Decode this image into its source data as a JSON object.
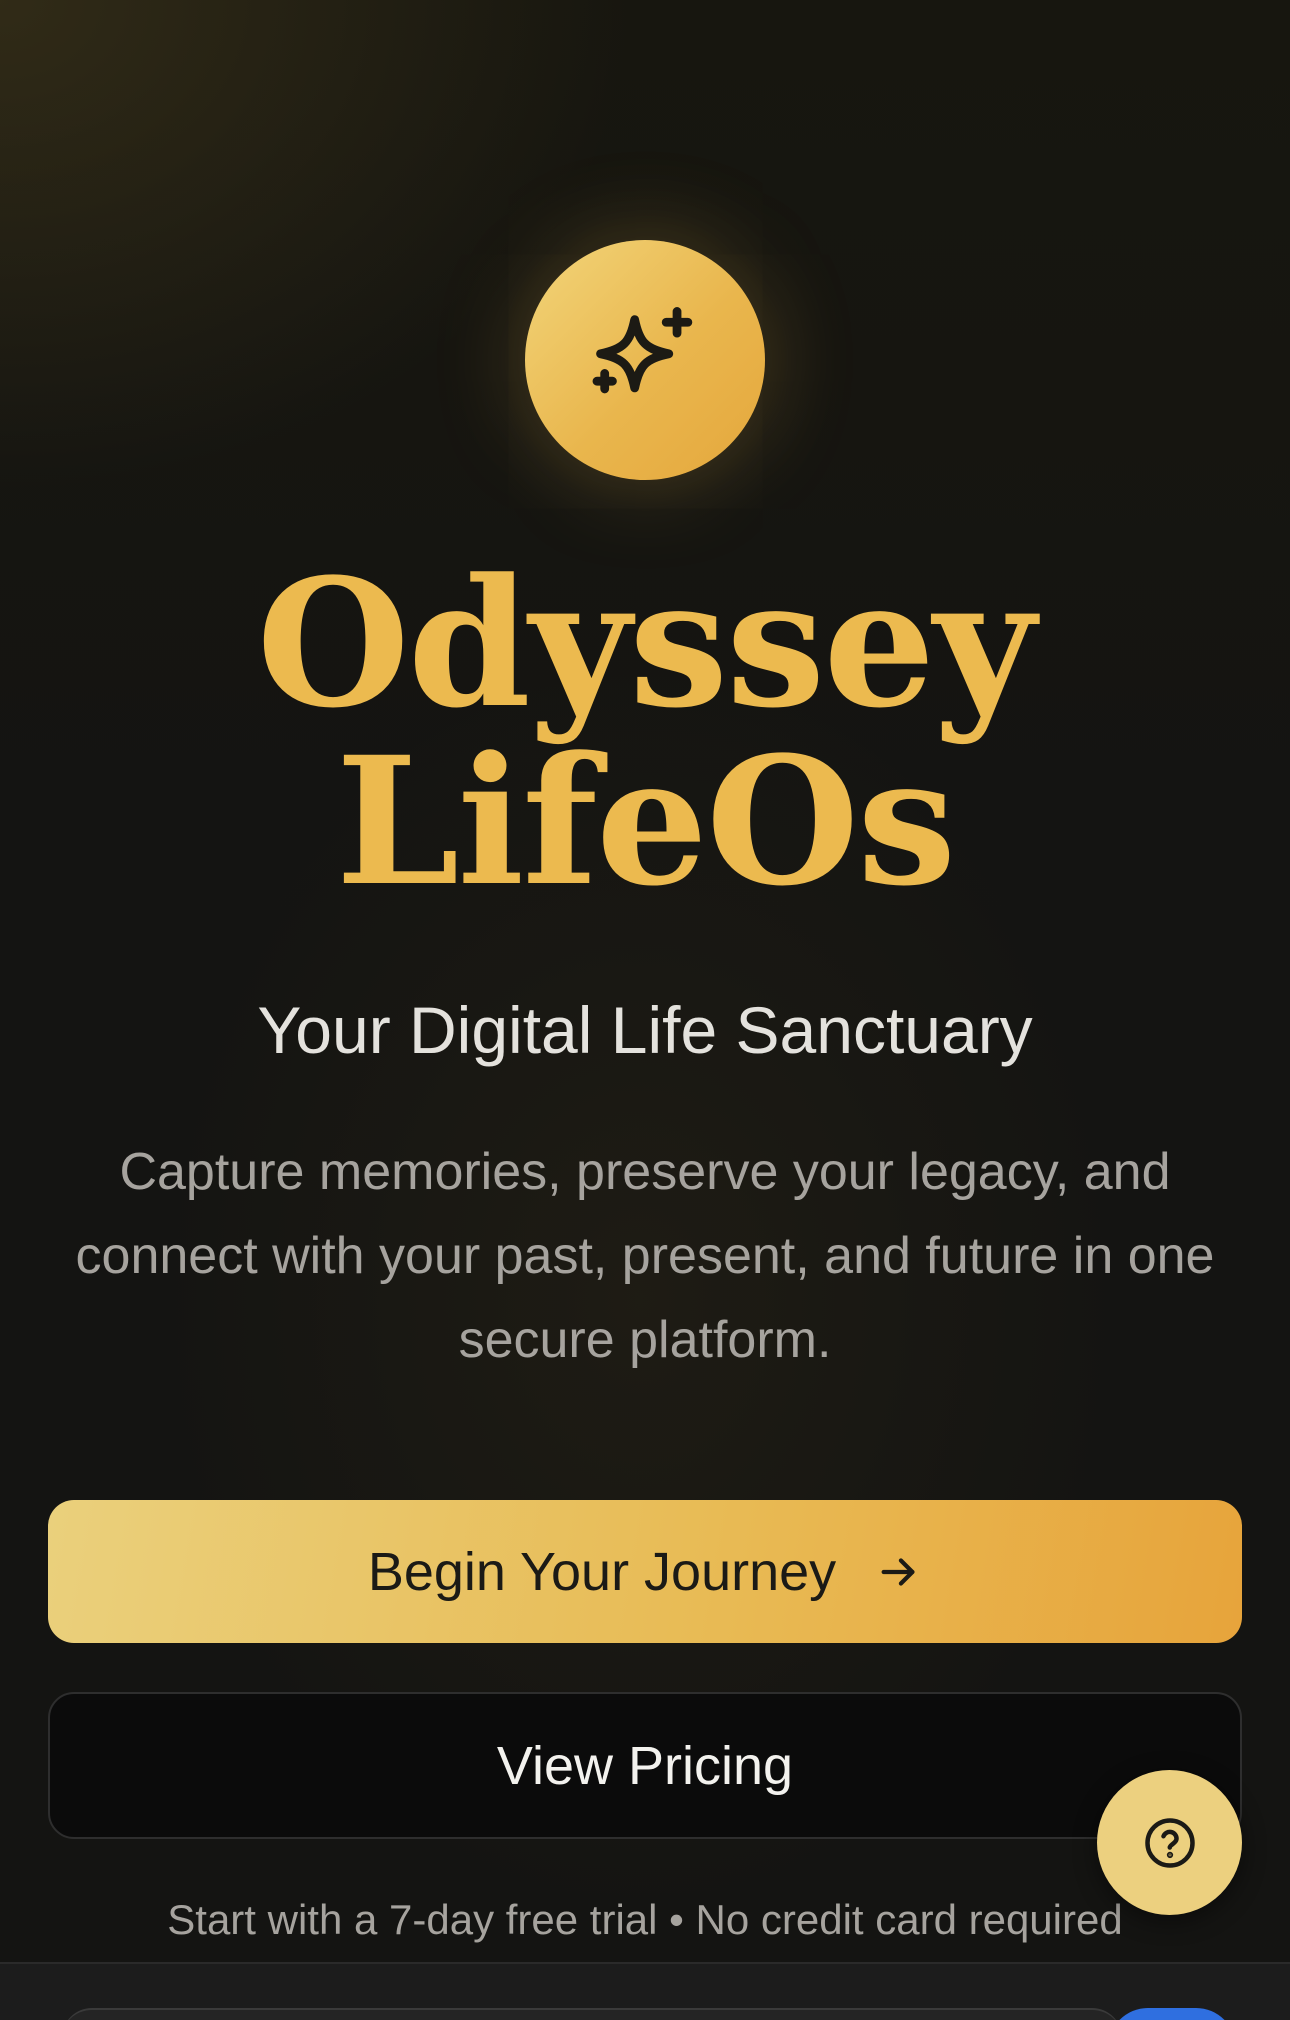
{
  "hero": {
    "logo_icon": "sparkles-icon",
    "title_line1": "Odyssey",
    "title_line2": "LifeOs",
    "subtitle": "Your Digital Life Sanctuary",
    "description": "Capture memories, preserve your legacy, and connect with your past, present, and future in one secure platform."
  },
  "actions": {
    "primary_label": "Begin Your Journey",
    "primary_icon": "arrow-right-icon",
    "secondary_label": "View Pricing"
  },
  "footnote": "Start with a 7-day free trial • No credit card required",
  "help": {
    "icon": "question-circle-icon"
  },
  "colors": {
    "accent_gold": "#ecba4f",
    "gradient_start": "#ead07c",
    "gradient_end": "#e7a43b",
    "background": "#141412",
    "subtitle_text": "#e4e2dd",
    "muted_text": "#a6a39e",
    "peek_blue": "#2f6fe0"
  }
}
